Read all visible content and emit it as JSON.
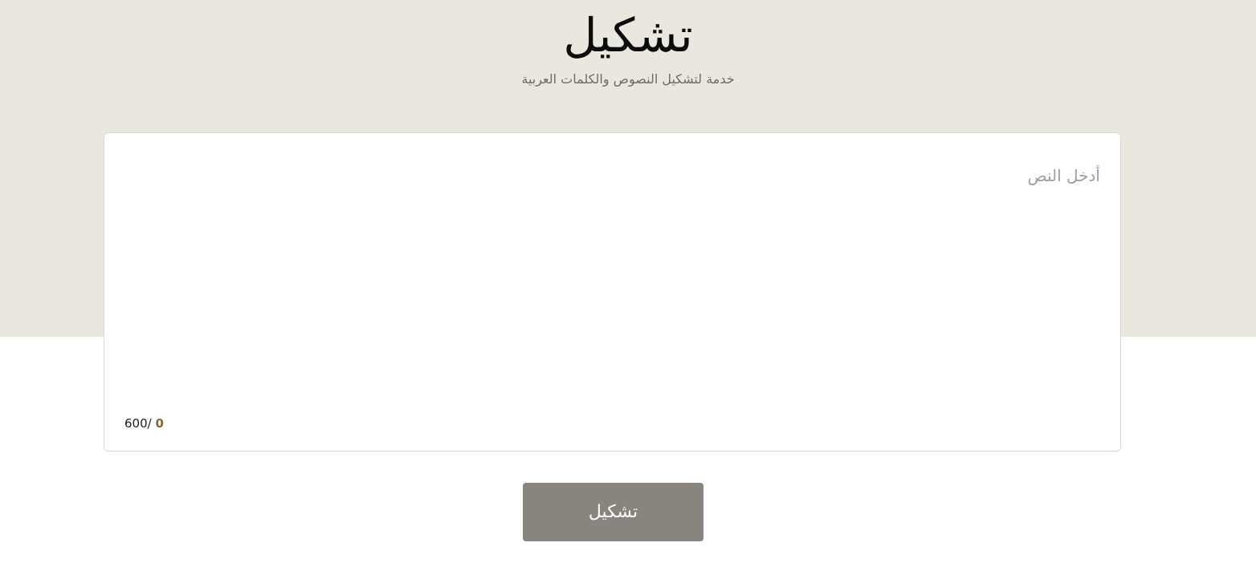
{
  "header": {
    "title": "تشكيل",
    "tagline": "خدمة لتشكيل النصوص والكلمات العربية"
  },
  "editor": {
    "value": "",
    "placeholder": "أدخل النص",
    "counter_current": "0",
    "counter_max": "600/"
  },
  "actions": {
    "submit_label": "تشكيل"
  },
  "colors": {
    "hero_background": "#eae7df",
    "button_background": "#8a847f",
    "counter_accent": "#8b6437",
    "placeholder": "#9c9cab"
  }
}
